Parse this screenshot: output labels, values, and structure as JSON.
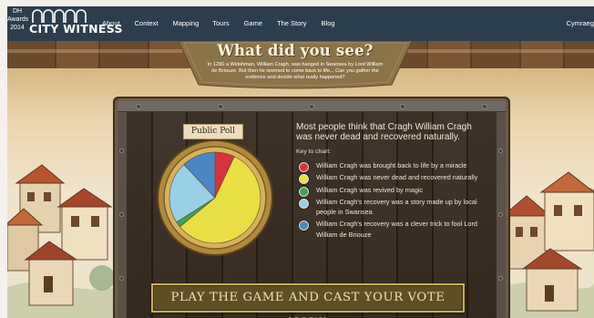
{
  "header": {
    "badge_lines": [
      "DH",
      "Awards",
      "2014"
    ],
    "logo_text": "CITY WITNESS",
    "nav": [
      {
        "label": "About"
      },
      {
        "label": "Context"
      },
      {
        "label": "Mapping"
      },
      {
        "label": "Tours"
      },
      {
        "label": "Game"
      },
      {
        "label": "The Story"
      },
      {
        "label": "Blog"
      }
    ],
    "language_link": "Cymraeg"
  },
  "banner": {
    "title": "What did you see?",
    "subtitle": "In 1290 a Welshman, William Cragh, was hanged in Swansea by Lord William de Briouze. But then he seemed to come back to life... Can you gather the evidence and decide what really happened?"
  },
  "poll": {
    "label": "Public Poll",
    "headline": "Most people think that Cragh William Cragh was never dead and recovered naturally.",
    "key_title": "Key to chart:",
    "legend": [
      {
        "text": "William Cragh was brought back to life by a miracle",
        "color": "#d8333e",
        "share": 0.07
      },
      {
        "text": "William Cragh was never dead and recovered naturally",
        "color": "#e9df44",
        "share": 0.57
      },
      {
        "text": "William Cragh was revived by magic",
        "color": "#3aa45a",
        "share": 0.02
      },
      {
        "text": "William Cragh's recovery was a story made up by local people in Swansea",
        "color": "#9ad0e6",
        "share": 0.22
      },
      {
        "text": "William Cragh's recovery was a clever trick to fool Lord William de Briouze",
        "color": "#4b86c4",
        "share": 0.12
      }
    ]
  },
  "chart_data": {
    "type": "pie",
    "title": "Public Poll",
    "categories": [
      "William Cragh was brought back to life by a miracle",
      "William Cragh was never dead and recovered naturally",
      "William Cragh was revived by magic",
      "William Cragh's recovery was a story made up by local people in Swansea",
      "William Cragh's recovery was a clever trick to fool Lord William de Briouze"
    ],
    "values": [
      0.07,
      0.57,
      0.02,
      0.22,
      0.12
    ],
    "colors": [
      "#d8333e",
      "#e9df44",
      "#3aa45a",
      "#9ad0e6",
      "#4b86c4"
    ]
  },
  "cta": {
    "label": "PLAY THE GAME AND CAST YOUR VOTE NOW!"
  }
}
